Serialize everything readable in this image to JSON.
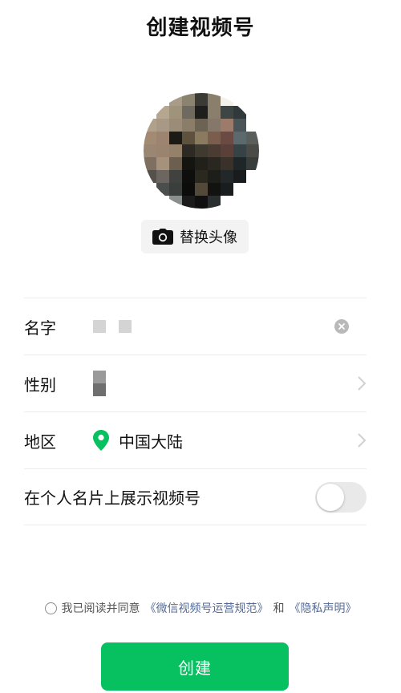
{
  "header": {
    "title": "创建视频号"
  },
  "avatar": {
    "change_label": "替换头像",
    "pixels": [
      "#ffffff",
      "#ffffff",
      "#a89b88",
      "#8c8270",
      "#3b3a34",
      "#8a7f6c",
      "#f4f1ea",
      "#ffffff",
      "#ffffff",
      "#ffffff",
      "#b5a78f",
      "#a0937c",
      "#6f6a5f",
      "#1e1e1c",
      "#8a7f6c",
      "#3e4545",
      "#31393a",
      "#ffffff",
      "#b0a28a",
      "#a79985",
      "#9a8c77",
      "#8a7e6b",
      "#6c6354",
      "#85786a",
      "#9c7b6b",
      "#4a5559",
      "#ffffff",
      "#a38b73",
      "#9c8470",
      "#1b1a14",
      "#5e523e",
      "#8a7a60",
      "#7a5d4d",
      "#6a4a43",
      "#5d6a6d",
      "#5a5f5c",
      "#9a8672",
      "#9a8470",
      "#95806a",
      "#2c2a22",
      "#3e3a30",
      "#4a3c33",
      "#5a4038",
      "#364246",
      "#4a4a46",
      "#7f6f61",
      "#a5917c",
      "#6d5f50",
      "#141410",
      "#22201a",
      "#2a2620",
      "#3a312a",
      "#1e2628",
      "#383c3a",
      "#56504b",
      "#6d6660",
      "#3f423e",
      "#0e0e0c",
      "#2a281f",
      "#1d1d19",
      "#22282a",
      "#181c1d",
      "#ffffff",
      "#ffffff",
      "#4a4e4d",
      "#3a3f3e",
      "#0c0c0a",
      "#52493a",
      "#121210",
      "#1a1d1e",
      "#ffffff",
      "#ffffff",
      "#ffffff",
      "#ffffff",
      "#8a8f8e",
      "#1a1b1a",
      "#101010",
      "#2b2e2e",
      "#ffffff",
      "#ffffff",
      "#ffffff"
    ]
  },
  "form": {
    "name": {
      "label": "名字"
    },
    "gender": {
      "label": "性别"
    },
    "region": {
      "label": "地区",
      "value": "中国大陆"
    },
    "show_on_card": {
      "label": "在个人名片上展示视频号",
      "enabled": false
    }
  },
  "agreement": {
    "prefix": "我已阅读并同意",
    "link1": "《微信视频号运营规范》",
    "conjunction": "和",
    "link2": "《隐私声明》"
  },
  "actions": {
    "create_label": "创建"
  },
  "colors": {
    "accent": "#07c160",
    "link": "#576b95",
    "pin": "#07c160"
  }
}
